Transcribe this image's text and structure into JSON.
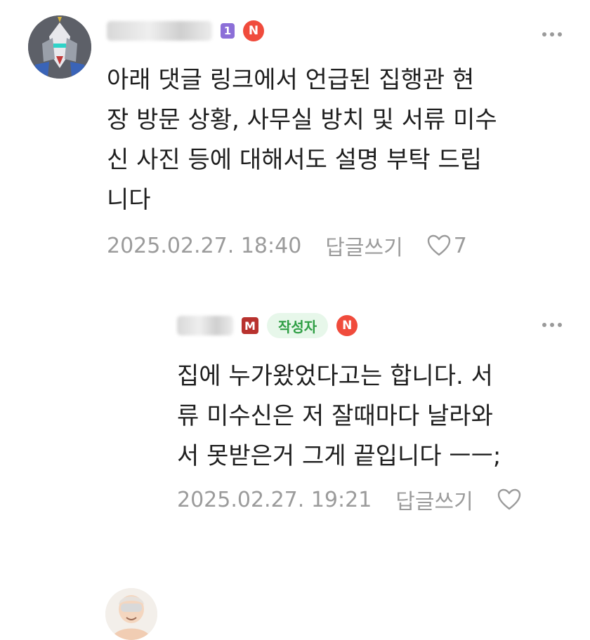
{
  "comments": [
    {
      "username": "",
      "level_badge": "1",
      "new_badge": "N",
      "text": "아래 댓글 링크에서 언급된 집행관 현\n장 방문 상황, 사무실 방치 및 서류 미수\n신 사진 등에 대해서도 설명 부탁 드립\n니다",
      "timestamp": "2025.02.27. 18:40",
      "reply_label": "답글쓰기",
      "like_count": "7",
      "more_icon": "more-dots-icon",
      "like_icon": "heart-outline-icon"
    },
    {
      "username": "",
      "level_badge": "M",
      "author_tag": "작성자",
      "new_badge": "N",
      "text": "집에 누가왔었다고는 합니다. 서\n류 미수신은 저 잘때마다 날라와\n서 못받은거 그게 끝입니다 ㅡㅡ;",
      "timestamp": "2025.02.27. 19:21",
      "reply_label": "답글쓰기",
      "like_count": "",
      "more_icon": "more-dots-icon",
      "like_icon": "heart-outline-icon"
    }
  ],
  "colors": {
    "text": "#1f1f1f",
    "meta": "#9b9b9b",
    "new_badge": "#f04b3c",
    "author_tag_bg": "#e7f7ea",
    "author_tag_fg": "#2f9e44",
    "level_purple": "#8c6fd8",
    "level_red": "#b8322e"
  }
}
